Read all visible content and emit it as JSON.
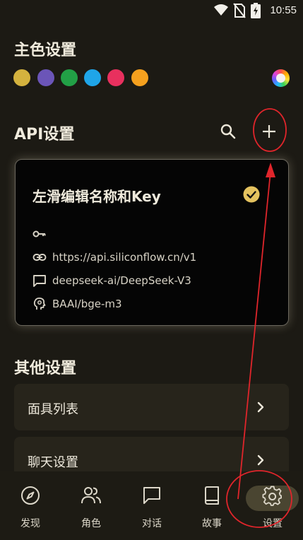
{
  "status_bar": {
    "time": "10:55"
  },
  "theme_section": {
    "title": "主色设置",
    "colors": [
      "#d4b23e",
      "#6b55b8",
      "#22a046",
      "#1fa5e8",
      "#e8305e",
      "#f5a01e"
    ]
  },
  "api_section": {
    "title": "API设置",
    "card": {
      "name": "左滑编辑名称和Key",
      "key": "",
      "url": "https://api.siliconflow.cn/v1",
      "chat_model": "deepseek-ai/DeepSeek-V3",
      "embedding_model": "BAAI/bge-m3"
    }
  },
  "other_section": {
    "title": "其他设置",
    "items": [
      {
        "label": "面具列表"
      },
      {
        "label": "聊天设置"
      }
    ]
  },
  "bottom_nav": {
    "items": [
      {
        "label": "发现"
      },
      {
        "label": "角色"
      },
      {
        "label": "对话"
      },
      {
        "label": "故事"
      },
      {
        "label": "设置"
      }
    ],
    "active": "设置"
  },
  "colors": {
    "background": "#1c1a14",
    "accent": "#e4c25f",
    "annotation": "#e0252b"
  }
}
